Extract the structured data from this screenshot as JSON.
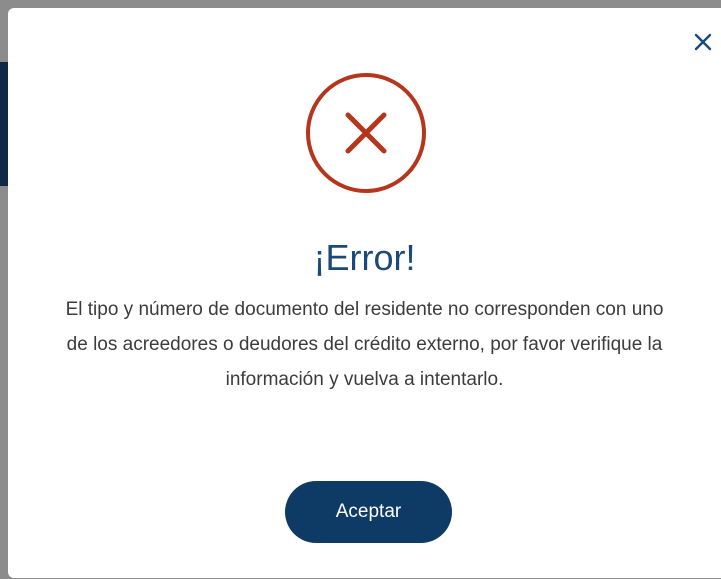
{
  "dialog": {
    "title": "¡Error!",
    "message": "El tipo y número de documento del residente no corresponden con uno de los acreedores o deudores del crédito externo, por favor verifique la información y vuelva a intentarlo.",
    "accept_label": "Aceptar",
    "close_icon": "close-icon",
    "status_icon": "error-circle-x-icon"
  },
  "colors": {
    "accent": "#0e3a66",
    "title": "#1b4a7a",
    "error": "#b5361c"
  }
}
